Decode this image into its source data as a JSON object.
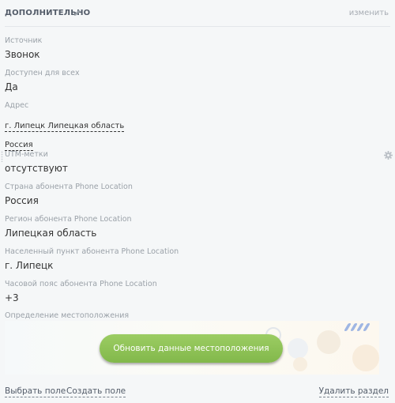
{
  "section": {
    "title": "ДОПОЛНИТЕЛЬНО",
    "action": "изменить"
  },
  "fields": {
    "source": {
      "label": "Источник",
      "value": "Звонок"
    },
    "available": {
      "label": "Доступен для всех",
      "value": "Да"
    },
    "address": {
      "label": "Адрес",
      "line1": "г. Липецк Липецкая область",
      "line2": "Россия"
    },
    "utm": {
      "label": "UTM-метки",
      "value": "отсутствуют"
    },
    "country": {
      "label": "Страна абонента Phone Location",
      "value": "Россия"
    },
    "region": {
      "label": "Регион абонента Phone Location",
      "value": "Липецкая область"
    },
    "city": {
      "label": "Населенный пункт абонента Phone Location",
      "value": "г. Липецк"
    },
    "timezone": {
      "label": "Часовой пояс абонента Phone Location",
      "value": "+3"
    },
    "geo": {
      "label": "Определение местоположения",
      "button": "Обновить данные местоположения"
    }
  },
  "footer": {
    "select_field": "Выбрать поле",
    "create_field": "Создать поле",
    "delete_section": "Удалить раздел"
  },
  "colors": {
    "button": "#8dc255",
    "label": "#9aa1a8",
    "text": "#333333",
    "background": "#f5f7f8"
  },
  "icons": [
    "pencil-icon",
    "gear-icon",
    "drag-handle-icon"
  ]
}
